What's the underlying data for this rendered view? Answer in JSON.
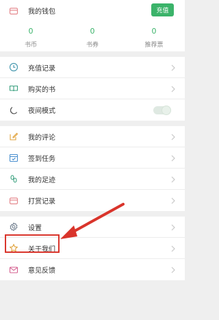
{
  "wallet": {
    "label": "我的钱包",
    "recharge_label": "充值",
    "stats": [
      {
        "value": "0",
        "label": "书币"
      },
      {
        "value": "0",
        "label": "书券"
      },
      {
        "value": "0",
        "label": "推荐票"
      }
    ]
  },
  "group1": [
    {
      "label": "充值记录",
      "icon": "clock-icon"
    },
    {
      "label": "购买的书",
      "icon": "book-icon"
    },
    {
      "label": "夜间模式",
      "icon": "moon-icon",
      "toggle": false
    }
  ],
  "group2": [
    {
      "label": "我的评论",
      "icon": "edit-icon"
    },
    {
      "label": "签到任务",
      "icon": "calendar-icon"
    },
    {
      "label": "我的足迹",
      "icon": "footprint-icon"
    },
    {
      "label": "打赏记录",
      "icon": "wallet-icon"
    }
  ],
  "group3": [
    {
      "label": "设置",
      "icon": "gear-icon"
    },
    {
      "label": "关于我们",
      "icon": "star-icon"
    },
    {
      "label": "意见反馈",
      "icon": "mail-icon"
    }
  ],
  "colors": {
    "accent": "#3bb36a",
    "annotation": "#d9342b",
    "icon": "#e58a8f"
  }
}
